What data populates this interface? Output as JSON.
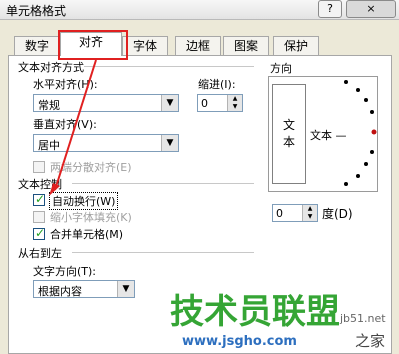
{
  "window": {
    "title": "单元格格式",
    "help_btn": "?",
    "close_btn": "×"
  },
  "tabs": [
    {
      "label": "数字",
      "active": false
    },
    {
      "label": "对齐",
      "active": true
    },
    {
      "label": "字体",
      "active": false
    },
    {
      "label": "边框",
      "active": false
    },
    {
      "label": "图案",
      "active": false
    },
    {
      "label": "保护",
      "active": false
    }
  ],
  "text_alignment": {
    "section_title": "文本对齐方式",
    "horizontal_label": "水平对齐(H):",
    "horizontal_value": "常规",
    "indent_label": "缩进(I):",
    "indent_value": "0",
    "vertical_label": "垂直对齐(V):",
    "vertical_value": "居中",
    "justify_distributed": {
      "label": "两端分散对齐(E)",
      "checked": false,
      "disabled": true
    }
  },
  "text_control": {
    "section_title": "文本控制",
    "wrap_text": {
      "label": "自动换行(W)",
      "checked": true
    },
    "shrink_to_fit": {
      "label": "缩小字体填充(K)",
      "checked": false,
      "disabled": true
    },
    "merge_cells": {
      "label": "合并单元格(M)",
      "checked": true
    }
  },
  "rtl": {
    "section_title": "从右到左",
    "direction_label": "文字方向(T):",
    "direction_value": "根据内容"
  },
  "orientation": {
    "section_title": "方向",
    "vertical_text": [
      "文",
      "本"
    ],
    "dial_text": "文本 —",
    "degree_value": "0",
    "degree_label": "度(D)"
  },
  "watermark": {
    "site_name": "技术员联盟",
    "url_main": "www.jsgho.com",
    "url_small": "jb51.net",
    "tagline": "之家"
  },
  "colors": {
    "annotation_red": "#e02020",
    "check_green": "#21a121",
    "watermark_green": "#35a535"
  }
}
